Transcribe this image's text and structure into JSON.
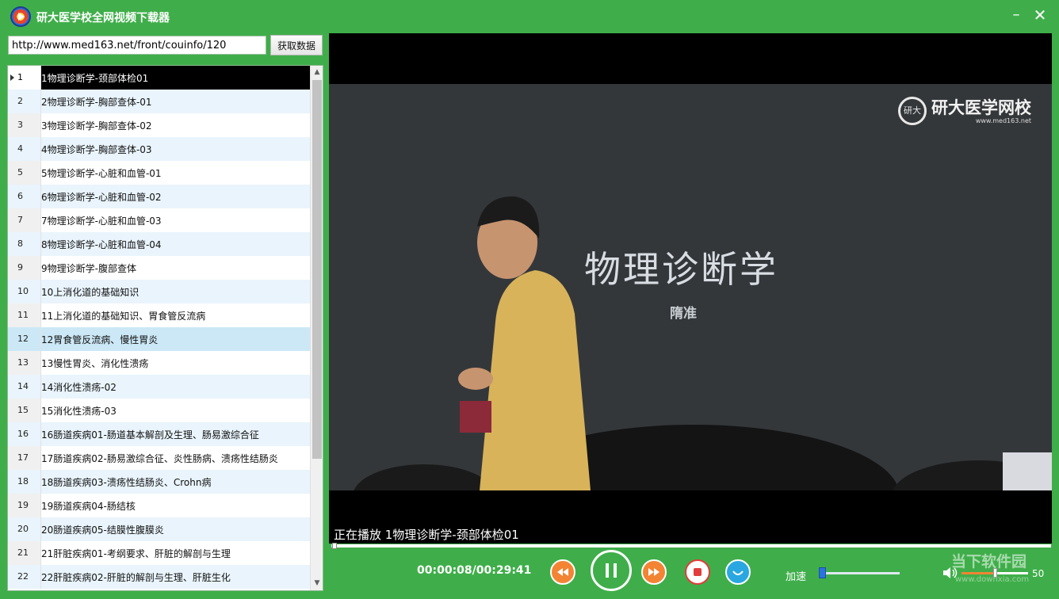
{
  "window": {
    "title": "研大医学校全网视频下载器",
    "minimize_glyph": "–",
    "close_glyph": "✕"
  },
  "toolbar": {
    "url_value": "http://www.med163.net/front/couinfo/120",
    "fetch_label": "获取数据"
  },
  "list": {
    "selected_index": 0,
    "highlighted_index": 11,
    "items": [
      {
        "num": "1",
        "title": "1物理诊断学-颈部体检01"
      },
      {
        "num": "2",
        "title": "2物理诊断学-胸部查体-01"
      },
      {
        "num": "3",
        "title": "3物理诊断学-胸部查体-02"
      },
      {
        "num": "4",
        "title": "4物理诊断学-胸部查体-03"
      },
      {
        "num": "5",
        "title": "5物理诊断学-心脏和血管-01"
      },
      {
        "num": "6",
        "title": "6物理诊断学-心脏和血管-02"
      },
      {
        "num": "7",
        "title": "7物理诊断学-心脏和血管-03"
      },
      {
        "num": "8",
        "title": "8物理诊断学-心脏和血管-04"
      },
      {
        "num": "9",
        "title": "9物理诊断学-腹部查体"
      },
      {
        "num": "10",
        "title": "10上消化道的基础知识"
      },
      {
        "num": "11",
        "title": "11上消化道的基础知识、胃食管反流病"
      },
      {
        "num": "12",
        "title": "12胃食管反流病、慢性胃炎"
      },
      {
        "num": "13",
        "title": "13慢性胃炎、消化性溃疡"
      },
      {
        "num": "14",
        "title": "14消化性溃疡-02"
      },
      {
        "num": "15",
        "title": "15消化性溃疡-03"
      },
      {
        "num": "16",
        "title": "16肠道疾病01-肠道基本解剖及生理、肠易激综合征"
      },
      {
        "num": "17",
        "title": "17肠道疾病02-肠易激综合征、炎性肠病、溃疡性结肠炎"
      },
      {
        "num": "18",
        "title": "18肠道疾病03-溃疡性结肠炎、Crohn病"
      },
      {
        "num": "19",
        "title": "19肠道疾病04-肠结核"
      },
      {
        "num": "20",
        "title": "20肠道疾病05-结膜性腹膜炎"
      },
      {
        "num": "21",
        "title": "21肝脏疾病01-考纲要求、肝脏的解剖与生理"
      },
      {
        "num": "22",
        "title": "22肝脏疾病02-肝脏的解剖与生理、肝脏生化"
      }
    ]
  },
  "video": {
    "slide_title": "物理诊断学",
    "slide_subtitle": "隋准",
    "brand_logo_text": "研大",
    "brand_name": "研大医学网校",
    "brand_url": "www.med163.net",
    "now_playing": "正在播放 1物理诊断学-颈部体检01"
  },
  "player": {
    "time_display": "00:00:08/00:29:41",
    "progress_fraction": 0.0045,
    "speed_label": "加速",
    "speed_fraction": 0.0,
    "volume_value": "50",
    "volume_fraction": 0.5
  },
  "watermark": {
    "text": "当下软件园",
    "url": "www.downxia.com"
  },
  "colors": {
    "frame": "#3fae4a",
    "accent_orange": "#f28434",
    "stop_red": "#e23c3c",
    "subtitle_blue": "#2aa7e0"
  }
}
